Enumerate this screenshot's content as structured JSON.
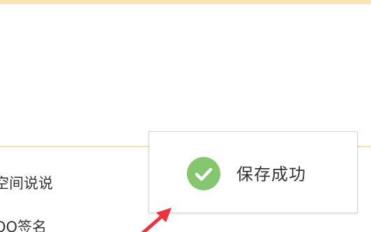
{
  "page": {
    "accent_color": "#f8e6b9",
    "divider_color": "#f6e2ae"
  },
  "options": [
    {
      "label": "空间说说"
    },
    {
      "label": "QQ签名"
    }
  ],
  "toast": {
    "message": "保存成功",
    "icon": "check-circle-icon",
    "icon_color": "#85c66f"
  },
  "annotation": {
    "icon": "red-arrow-icon",
    "color": "#e8343a"
  }
}
